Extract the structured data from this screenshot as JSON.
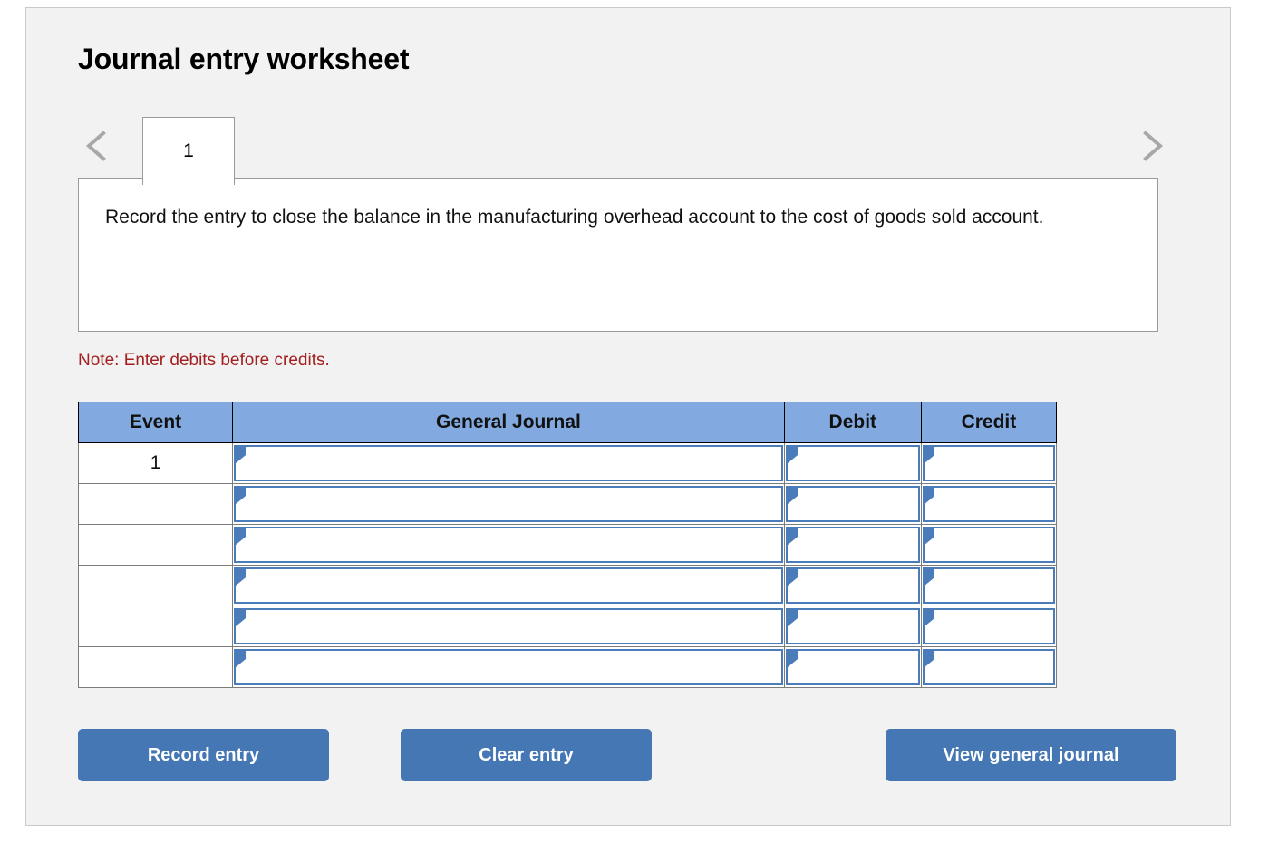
{
  "panel": {
    "title": "Journal entry worksheet"
  },
  "nav": {
    "prev_icon": "chevron-left-icon",
    "next_icon": "chevron-right-icon"
  },
  "tabs": [
    {
      "label": "1",
      "active": true
    }
  ],
  "description": {
    "text": "Record the entry to close the balance in the manufacturing overhead account to the cost of goods sold account."
  },
  "note": {
    "text": "Note: Enter debits before credits."
  },
  "table": {
    "headers": [
      "Event",
      "General Journal",
      "Debit",
      "Credit"
    ],
    "rows": [
      {
        "event": "1",
        "general_journal": "",
        "debit": "",
        "credit": ""
      },
      {
        "event": "",
        "general_journal": "",
        "debit": "",
        "credit": ""
      },
      {
        "event": "",
        "general_journal": "",
        "debit": "",
        "credit": ""
      },
      {
        "event": "",
        "general_journal": "",
        "debit": "",
        "credit": ""
      },
      {
        "event": "",
        "general_journal": "",
        "debit": "",
        "credit": ""
      },
      {
        "event": "",
        "general_journal": "",
        "debit": "",
        "credit": ""
      }
    ]
  },
  "buttons": {
    "record": "Record entry",
    "clear": "Clear entry",
    "view": "View general journal"
  },
  "colors": {
    "panel_bg": "#f2f2f2",
    "header_blue": "#82aae0",
    "button_blue": "#4477b4",
    "note_red": "#a32020",
    "input_border_blue": "#4a7cba"
  }
}
